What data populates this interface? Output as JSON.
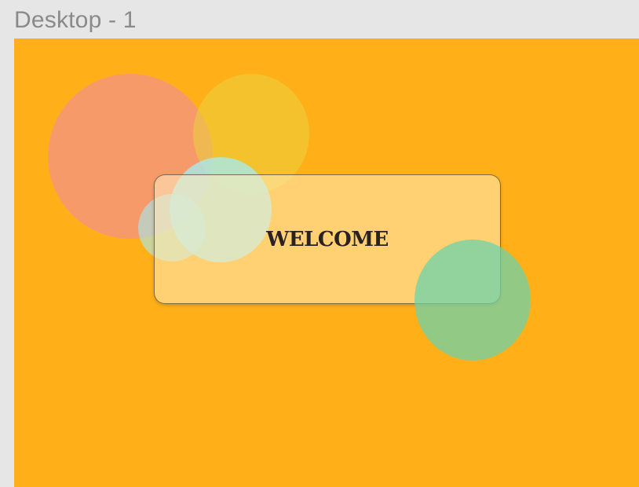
{
  "frame": {
    "label": "Desktop - 1",
    "background_color": "#ffb019"
  },
  "card": {
    "text": "WELCOME"
  },
  "decorations": {
    "circle_colors": [
      "#f08ca0",
      "#ebd23c",
      "#a5ebf0",
      "#a5ebf0",
      "#6ed2aa"
    ]
  }
}
